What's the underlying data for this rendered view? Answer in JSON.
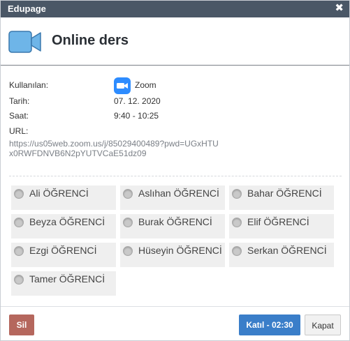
{
  "window": {
    "title": "Edupage",
    "close_glyph": "✖"
  },
  "header": {
    "title": "Online ders",
    "icon": "video-camera-icon",
    "icon_color": "#6eb5e8"
  },
  "info": {
    "platform_label": "Kullanılan:",
    "platform_value": "Zoom",
    "platform_icon": "zoom-icon",
    "date_label": "Tarih:",
    "date_value": "07. 12. 2020",
    "time_label": "Saat:",
    "time_value": "9:40 - 10:25",
    "url_label": "URL:",
    "url_value": "https://us05web.zoom.us/j/85029400489?pwd=UGxHTUx0RWFDNVB6N2pYUTVCaE51dz09"
  },
  "students": [
    {
      "name": "Ali ÖĞRENCİ"
    },
    {
      "name": "Aslıhan ÖĞRENCİ"
    },
    {
      "name": "Bahar  ÖĞRENCİ"
    },
    {
      "name": "Beyza ÖĞRENCİ"
    },
    {
      "name": "Burak ÖĞRENCİ"
    },
    {
      "name": "Elif ÖĞRENCİ"
    },
    {
      "name": "Ezgi ÖĞRENCİ"
    },
    {
      "name": "Hüseyin ÖĞRENCİ"
    },
    {
      "name": "Serkan ÖĞRENCİ"
    },
    {
      "name": "Tamer ÖĞRENCİ"
    }
  ],
  "buttons": {
    "delete_label": "Sil",
    "join_label": "Katıl - 02:30",
    "close_label": "Kapat"
  },
  "colors": {
    "titlebar": "#4a5766",
    "zoom_blue": "#2d8cff",
    "join_button": "#3a7ec9",
    "delete_button": "#b5675d"
  }
}
